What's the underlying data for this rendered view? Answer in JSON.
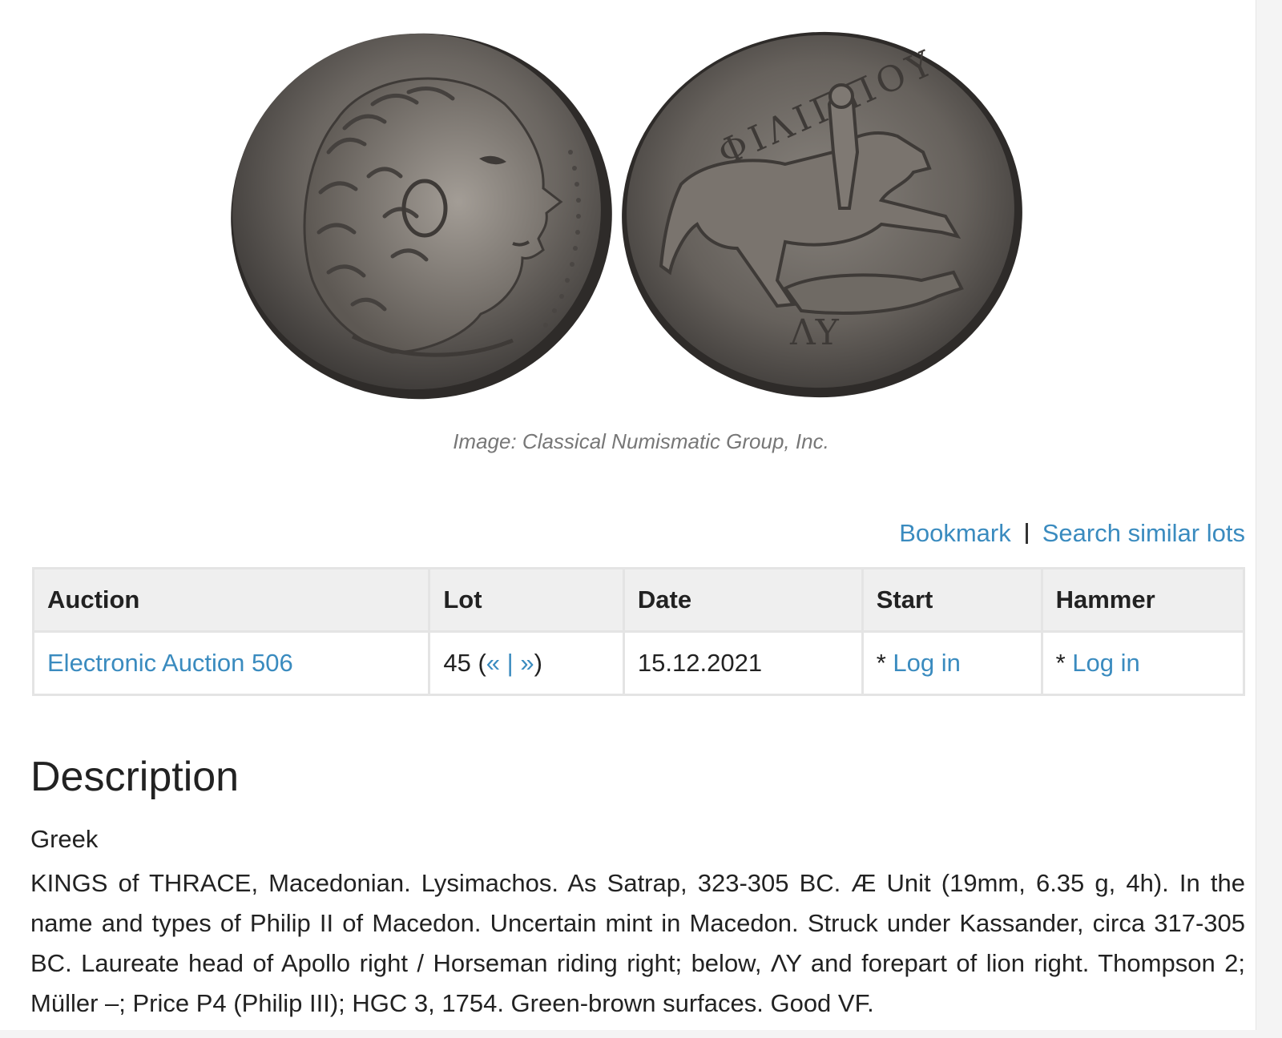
{
  "image": {
    "caption": "Image: Classical Numismatic Group, Inc.",
    "obverse_legend": "",
    "reverse_legend": "ΦΙΛΙΠΠΟΥ",
    "reverse_monogram": "ΛΥ"
  },
  "actions": {
    "bookmark_label": "Bookmark",
    "separator": "|",
    "search_similar_label": "Search similar lots"
  },
  "table": {
    "headers": {
      "auction": "Auction",
      "lot": "Lot",
      "date": "Date",
      "start": "Start",
      "hammer": "Hammer"
    },
    "row": {
      "auction": "Electronic Auction 506",
      "lot_number": "45",
      "lot_open": "(",
      "lot_prev": "«",
      "lot_sep": "|",
      "lot_next": "»",
      "lot_close": ")",
      "date": "15.12.2021",
      "start_prefix": "* ",
      "start_link": "Log in",
      "hammer_prefix": "* ",
      "hammer_link": "Log in"
    }
  },
  "description": {
    "heading": "Description",
    "category": "Greek",
    "body": "KINGS of THRACE, Macedonian. Lysimachos. As Satrap, 323-305 BC. Æ Unit (19mm, 6.35 g, 4h). In the name and types of Philip II of Macedon. Uncertain mint in Macedon. Struck under Kassander, circa 317-305 BC. Laureate head of Apollo right / Horseman riding right; below, ΛΥ and forepart of lion right. Thompson 2; Müller –; Price P4 (Philip III); HGC 3, 1754. Green-brown surfaces. Good VF."
  },
  "colors": {
    "link": "#3a8bbf",
    "header_bg": "#efefef",
    "border": "#e4e4e4",
    "caption": "#777777",
    "coin_dark": "#3b3836",
    "coin_mid": "#6b6661",
    "coin_light": "#9a948e"
  }
}
